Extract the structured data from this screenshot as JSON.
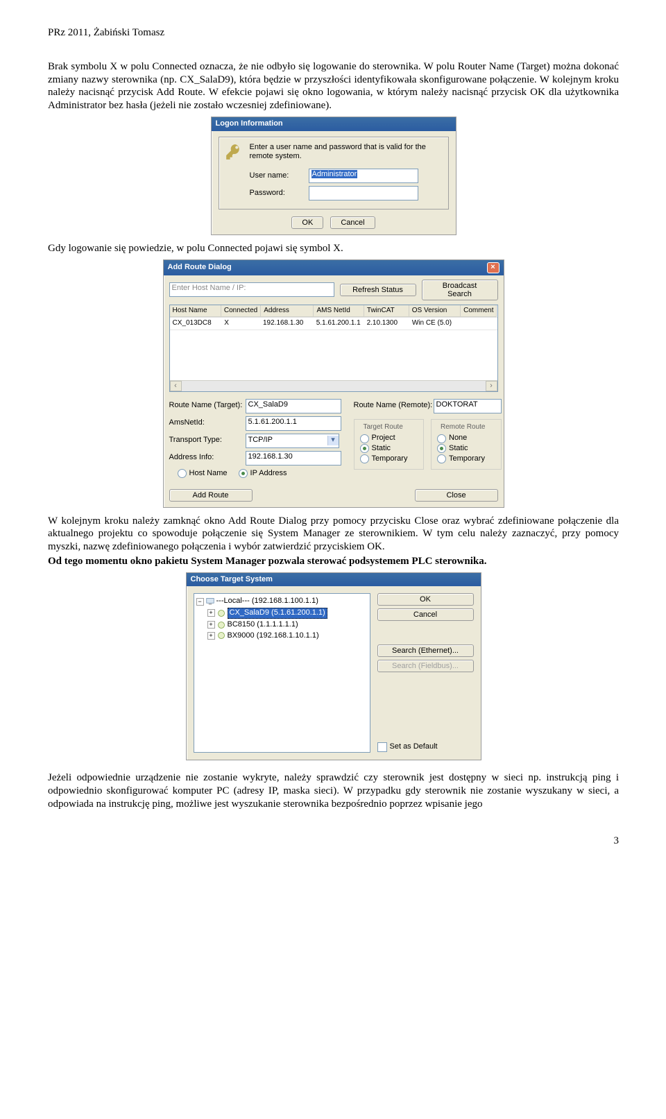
{
  "header": "PRz 2011, Żabiński Tomasz",
  "p1": "Brak symbolu X w polu Connected oznacza, że nie odbyło się logowanie do sterownika. W polu Router Name (Target) można dokonać zmiany nazwy sterownika (np. CX_SalaD9), która będzie w przyszłości identyfikowała skonfigurowane połączenie. W kolejnym kroku należy nacisnąć przycisk Add Route. W efekcie pojawi się okno logowania, w którym należy nacisnąć przycisk OK dla użytkownika Administrator bez hasła (jeżeli nie zostało wczesniej zdefiniowane).",
  "p2": "Gdy logowanie się powiedzie, w polu Connected pojawi się symbol X.",
  "p3": "W kolejnym kroku należy zamknąć okno Add Route Dialog przy pomocy przycisku Close oraz wybrać zdefiniowane połączenie dla aktualnego projektu co spowoduje połączenie się System Manager ze sterownikiem. W tym celu należy zaznaczyć, przy pomocy myszki, nazwę zdefiniowanego połączenia i wybór zatwierdzić przyciskiem OK.",
  "p3b": "Od tego momentu okno pakietu System Manager pozwala sterować podsystemem PLC sterownika.",
  "p4": "Jeżeli odpowiednie urządzenie nie zostanie wykryte, należy sprawdzić czy sterownik jest dostępny w sieci np. instrukcją ping i odpowiednio skonfigurować komputer PC (adresy IP, maska sieci). W przypadku gdy sterownik nie zostanie wyszukany w sieci, a odpowiada na instrukcję ping, możliwe jest wyszukanie sterownika bezpośrednio poprzez wpisanie jego",
  "logon": {
    "title": "Logon Information",
    "hint": "Enter a user name and password that is valid for the remote system.",
    "userLabel": "User name:",
    "userValue": "Administrator",
    "passLabel": "Password:",
    "ok": "OK",
    "cancel": "Cancel"
  },
  "ard": {
    "title": "Add Route Dialog",
    "hostPlaceholder": "Enter Host Name / IP:",
    "refresh": "Refresh Status",
    "broadcast": "Broadcast Search",
    "cols": {
      "host": "Host Name",
      "conn": "Connected",
      "addr": "Address",
      "netid": "AMS NetId",
      "twin": "TwinCAT",
      "os": "OS Version",
      "comm": "Comment"
    },
    "row": {
      "host": "CX_013DC8",
      "conn": "X",
      "addr": "192.168.1.30",
      "netid": "5.1.61.200.1.1",
      "twin": "2.10.1300",
      "os": "Win CE (5.0)",
      "comm": ""
    },
    "routeNameTLabel": "Route Name (Target):",
    "routeNameT": "CX_SalaD9",
    "amsLabel": "AmsNetId:",
    "ams": "5.1.61.200.1.1",
    "transportLabel": "Transport Type:",
    "transport": "TCP/IP",
    "addrInfoLabel": "Address Info:",
    "addrInfo": "192.168.1.30",
    "hostName": "Host Name",
    "ipAddress": "IP Address",
    "routeNameRLabel": "Route Name (Remote):",
    "routeNameR": "DOKTORAT",
    "targetRoute": "Target Route",
    "remoteRoute": "Remote Route",
    "project": "Project",
    "static": "Static",
    "temporary": "Temporary",
    "none": "None",
    "addRoute": "Add Route",
    "close": "Close"
  },
  "cts": {
    "title": "Choose Target System",
    "local": "---Local---   (192.168.1.100.1.1)",
    "n1": "CX_SalaD9   (5.1.61.200.1.1)",
    "n2": "BC8150   (1.1.1.1.1.1)",
    "n3": "BX9000   (192.168.1.10.1.1)",
    "ok": "OK",
    "cancel": "Cancel",
    "searchE": "Search (Ethernet)...",
    "searchF": "Search (Fieldbus)...",
    "setDefault": "Set as Default"
  },
  "pageNum": "3"
}
